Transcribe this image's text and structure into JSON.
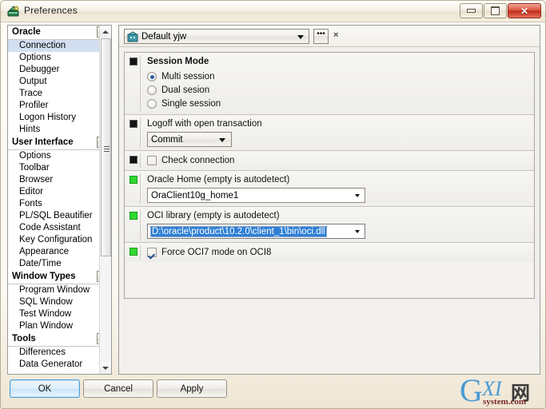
{
  "window": {
    "title": "Preferences",
    "app_icon": "preferences-app-icon",
    "controls": {
      "minimize": "minimize-icon",
      "maximize": "maximize-icon",
      "close": "close-icon"
    }
  },
  "sidebar": {
    "groups": [
      {
        "label": "Oracle",
        "items": [
          {
            "label": "Connection",
            "selected": true
          },
          {
            "label": "Options",
            "selected": false
          },
          {
            "label": "Debugger",
            "selected": false
          },
          {
            "label": "Output",
            "selected": false
          },
          {
            "label": "Trace",
            "selected": false
          },
          {
            "label": "Profiler",
            "selected": false
          },
          {
            "label": "Logon History",
            "selected": false
          },
          {
            "label": "Hints",
            "selected": false
          }
        ]
      },
      {
        "label": "User Interface",
        "items": [
          {
            "label": "Options",
            "selected": false
          },
          {
            "label": "Toolbar",
            "selected": false
          },
          {
            "label": "Browser",
            "selected": false
          },
          {
            "label": "Editor",
            "selected": false
          },
          {
            "label": "Fonts",
            "selected": false
          },
          {
            "label": "PL/SQL Beautifier",
            "selected": false
          },
          {
            "label": "Code Assistant",
            "selected": false
          },
          {
            "label": "Key Configuration",
            "selected": false
          },
          {
            "label": "Appearance",
            "selected": false
          },
          {
            "label": "Date/Time",
            "selected": false
          }
        ]
      },
      {
        "label": "Window Types",
        "items": [
          {
            "label": "Program Window",
            "selected": false
          },
          {
            "label": "SQL Window",
            "selected": false
          },
          {
            "label": "Test Window",
            "selected": false
          },
          {
            "label": "Plan Window",
            "selected": false
          }
        ]
      },
      {
        "label": "Tools",
        "items": [
          {
            "label": "Differences",
            "selected": false
          },
          {
            "label": "Data Generator",
            "selected": false
          }
        ]
      }
    ]
  },
  "toolbar": {
    "profile_value": "Default yjw",
    "profile_icon": "profile-icon",
    "ellipsis_label": "•••",
    "mark_label": "×"
  },
  "sections": [
    {
      "marker": "black",
      "title": "Session Mode",
      "radios": [
        {
          "label": "Multi session",
          "checked": true
        },
        {
          "label": "Dual sesion",
          "checked": false
        },
        {
          "label": "Single session",
          "checked": false
        }
      ]
    },
    {
      "marker": "black",
      "title": "Logoff with open transaction",
      "combo_value": "Commit"
    },
    {
      "marker": "black",
      "checkbox": {
        "label": "Check connection",
        "checked": false
      }
    },
    {
      "marker": "green",
      "title": "Oracle Home (empty is autodetect)",
      "combo_value": "OraClient10g_home1"
    },
    {
      "marker": "green",
      "title": "OCI library (empty is autodetect)",
      "combo_value": "D:\\oracle\\product\\10.2.0\\client_1\\bin\\oci.dll"
    },
    {
      "marker": "green",
      "checkbox": {
        "label": "Force OCI7 mode on OCI8",
        "checked": true
      }
    }
  ],
  "buttons": {
    "ok": "OK",
    "cancel": "Cancel",
    "apply": "Apply"
  },
  "watermark": {
    "g": "G",
    "xi": "XI",
    "cn": "网",
    "domain": "system.com"
  },
  "colors": {
    "selection_blue": "#2f7fd6",
    "tree_selection": "#d3dff1",
    "marker_green": "#2fd92f",
    "marker_black": "#131313",
    "close_red": "#bf2a17"
  }
}
